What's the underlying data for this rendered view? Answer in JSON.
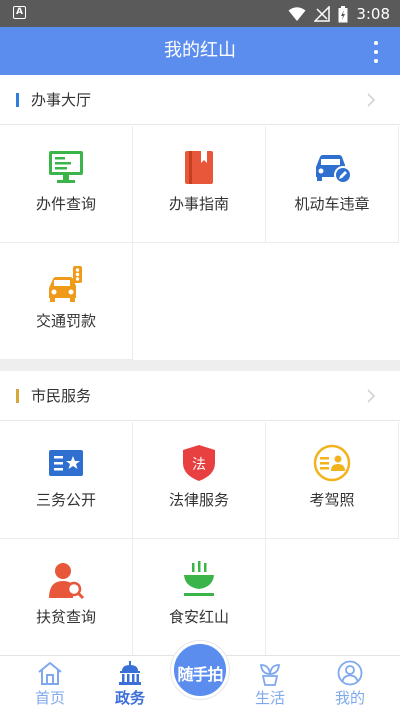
{
  "status_bar": {
    "left_badge": "A",
    "time": "3:08",
    "icons": [
      "wifi-icon",
      "signal-off-icon",
      "battery-charging-icon"
    ]
  },
  "app_bar": {
    "title": "我的红山",
    "menu_icon": "more-vert-icon"
  },
  "sections": [
    {
      "title": "办事大厅",
      "accent": "#2f7fd6",
      "items": [
        {
          "label": "办件查询",
          "icon": "monitor-icon",
          "color": "#3bb54a"
        },
        {
          "label": "办事指南",
          "icon": "book-icon",
          "color": "#e8573a"
        },
        {
          "label": "机动车违章",
          "icon": "car-edit-icon",
          "color": "#2f6fd0"
        },
        {
          "label": "交通罚款",
          "icon": "car-traffic-light-icon",
          "color": "#f09a1a"
        }
      ]
    },
    {
      "title": "市民服务",
      "accent": "#d4a93a",
      "items": [
        {
          "label": "三务公开",
          "icon": "id-card-star-icon",
          "color": "#2f6fd0"
        },
        {
          "label": "法律服务",
          "icon": "law-shield-icon",
          "color": "#e84040"
        },
        {
          "label": "考驾照",
          "icon": "license-person-icon",
          "color": "#f2b21a"
        },
        {
          "label": "扶贫查询",
          "icon": "person-search-icon",
          "color": "#e8573a"
        },
        {
          "label": "食安红山",
          "icon": "food-bowl-icon",
          "color": "#3bb54a"
        }
      ]
    }
  ],
  "tab_bar": {
    "tabs": [
      {
        "label": "首页",
        "icon": "home-icon",
        "active": false
      },
      {
        "label": "政务",
        "icon": "government-building-icon",
        "active": true
      },
      {
        "label": "生活",
        "icon": "plant-icon",
        "active": false
      },
      {
        "label": "我的",
        "icon": "user-icon",
        "active": false
      }
    ],
    "center_button_label": "随手拍",
    "active_color": "#5b8def",
    "inactive_color": "#7fa8ee"
  }
}
